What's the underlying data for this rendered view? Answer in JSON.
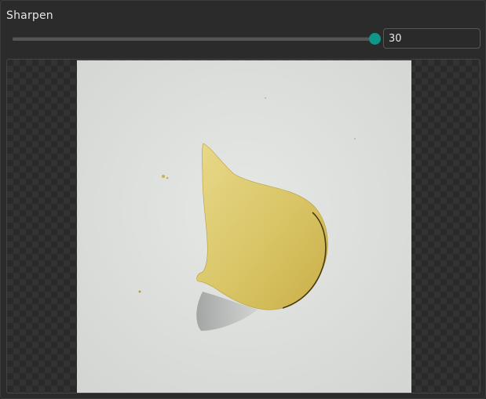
{
  "panel": {
    "title": "Sharpen"
  },
  "slider": {
    "value": 30,
    "max": 30,
    "accent_color": "#0f9688"
  },
  "input": {
    "value": "30"
  },
  "preview": {
    "background": "checkerboard",
    "image_subject": "potato-chip-photo"
  }
}
